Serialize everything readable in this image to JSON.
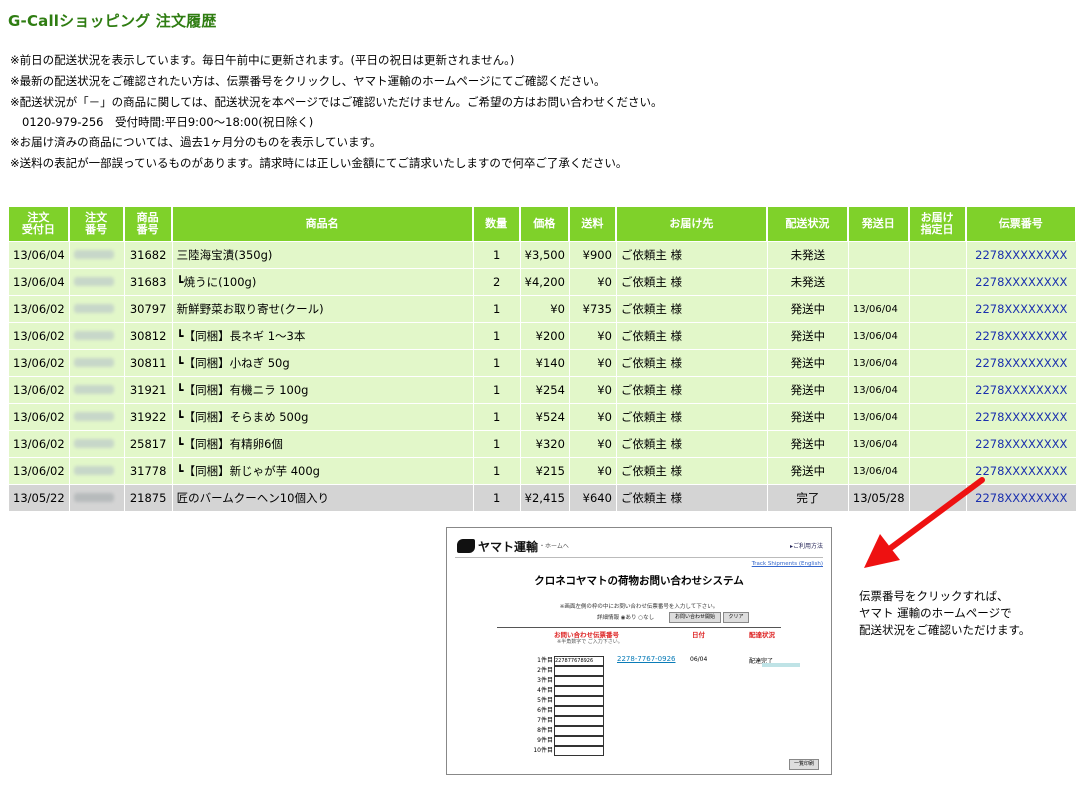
{
  "title": "G-Callショッピング 注文履歴",
  "notes": [
    "※前日の配送状況を表示しています。毎日午前中に更新されます。(平日の祝日は更新されません。)",
    "※最新の配送状況をご確認されたい方は、伝票番号をクリックし、ヤマト運輸のホームページにてご確認ください。",
    "※配送状況が「－」の商品に関しては、配送状況を本ページではご確認いただけません。ご希望の方はお問い合わせください。",
    "0120-979-256　受付時間:平日9:00～18:00(祝日除く)",
    "※お届け済みの商品については、過去1ヶ月分のものを表示しています。",
    "※送料の表記が一部誤っているものがあります。請求時には正しい金額にてご請求いたしますので何卒ご了承ください。"
  ],
  "table": {
    "headers": {
      "order_date": [
        "注文",
        "受付日"
      ],
      "order_no": [
        "注文",
        "番号"
      ],
      "product_no": [
        "商品",
        "番号"
      ],
      "product_name": "商品名",
      "qty": "数量",
      "price": "価格",
      "shipping": "送料",
      "recipient": "お届け先",
      "status": "配送状況",
      "ship_date": "発送日",
      "delivery_date": [
        "お届け",
        "指定日"
      ],
      "slip_no": "伝票番号"
    },
    "rows": [
      {
        "date": "13/06/04",
        "product_no": "31682",
        "name": "三陸海宝漬(350g)",
        "qty": "1",
        "price": "¥3,500",
        "shipping": "¥900",
        "recipient": "ご依頼主 様",
        "status": "未発送",
        "ship_date": "",
        "slip": "2278XXXXXXXX",
        "style": "green"
      },
      {
        "date": "13/06/04",
        "product_no": "31683",
        "name": "┗焼うに(100g)",
        "qty": "2",
        "price": "¥4,200",
        "shipping": "¥0",
        "recipient": "ご依頼主 様",
        "status": "未発送",
        "ship_date": "",
        "slip": "2278XXXXXXXX",
        "style": "green"
      },
      {
        "date": "13/06/02",
        "product_no": "30797",
        "name": "新鮮野菜お取り寄せ(クール)",
        "qty": "1",
        "price": "¥0",
        "shipping": "¥735",
        "recipient": "ご依頼主 様",
        "status": "発送中",
        "ship_date": "13/06/04",
        "slip": "2278XXXXXXXX",
        "style": "green"
      },
      {
        "date": "13/06/02",
        "product_no": "30812",
        "name": "┗【同梱】長ネギ 1～3本",
        "qty": "1",
        "price": "¥200",
        "shipping": "¥0",
        "recipient": "ご依頼主 様",
        "status": "発送中",
        "ship_date": "13/06/04",
        "slip": "2278XXXXXXXX",
        "style": "green"
      },
      {
        "date": "13/06/02",
        "product_no": "30811",
        "name": "┗【同梱】小ねぎ 50g",
        "qty": "1",
        "price": "¥140",
        "shipping": "¥0",
        "recipient": "ご依頼主 様",
        "status": "発送中",
        "ship_date": "13/06/04",
        "slip": "2278XXXXXXXX",
        "style": "green"
      },
      {
        "date": "13/06/02",
        "product_no": "31921",
        "name": "┗【同梱】有機ニラ 100g",
        "qty": "1",
        "price": "¥254",
        "shipping": "¥0",
        "recipient": "ご依頼主 様",
        "status": "発送中",
        "ship_date": "13/06/04",
        "slip": "2278XXXXXXXX",
        "style": "green"
      },
      {
        "date": "13/06/02",
        "product_no": "31922",
        "name": "┗【同梱】そらまめ 500g",
        "qty": "1",
        "price": "¥524",
        "shipping": "¥0",
        "recipient": "ご依頼主 様",
        "status": "発送中",
        "ship_date": "13/06/04",
        "slip": "2278XXXXXXXX",
        "style": "green"
      },
      {
        "date": "13/06/02",
        "product_no": "25817",
        "name": "┗【同梱】有精卵6個",
        "qty": "1",
        "price": "¥320",
        "shipping": "¥0",
        "recipient": "ご依頼主 様",
        "status": "発送中",
        "ship_date": "13/06/04",
        "slip": "2278XXXXXXXX",
        "style": "green"
      },
      {
        "date": "13/06/02",
        "product_no": "31778",
        "name": "┗【同梱】新じゃが芋 400g",
        "qty": "1",
        "price": "¥215",
        "shipping": "¥0",
        "recipient": "ご依頼主 様",
        "status": "発送中",
        "ship_date": "13/06/04",
        "slip": "2278XXXXXXXX",
        "style": "green"
      },
      {
        "date": "13/05/22",
        "product_no": "21875",
        "name": "匠のバームクーヘン10個入り",
        "qty": "1",
        "price": "¥2,415",
        "shipping": "¥640",
        "recipient": "ご依頼主 様",
        "status": "完了",
        "ship_date": "13/05/28",
        "slip": "2278XXXXXXXX",
        "style": "gray"
      }
    ]
  },
  "screenshot": {
    "logo": "ヤマト運輸",
    "home_link": "・ホームへ",
    "help_link": "▸ご利用方法",
    "track_link": "Track Shipments (English)",
    "system_title": "クロネコヤマトの荷物お問い合わせシステム",
    "instruction": "※画面左側の枠の中にお問い合わせ伝票番号を入力して下さい。",
    "detail_label": "詳細情報 ◉あり ○なし",
    "search_button": "お問い合わせ開始",
    "clear_button": "クリア",
    "col_slip": "お問い合わせ伝票番号",
    "col_date": "日付",
    "col_status": "配達状況",
    "note": "※半角数字で ご入力下さい。",
    "row_labels": [
      "1件目",
      "2件目",
      "3件目",
      "4件目",
      "5件目",
      "6件目",
      "7件目",
      "8件目",
      "9件目",
      "10件目"
    ],
    "first_input": "227877678926",
    "tracking_number": "2278-7767-0926",
    "tracking_date": "06/04",
    "tracking_status": "配達完了",
    "list_button": "一覧印刷"
  },
  "explanation": [
    "伝票番号をクリックすれば、",
    "ヤマト 運輸のホームページで",
    "配送状況をご確認いただけます。"
  ],
  "colors": {
    "header_green": "#7fd12a",
    "row_green": "#e2f7c9",
    "row_gray": "#d4d4d4",
    "title_green": "#2f7d12",
    "link_blue": "#1a2fae",
    "arrow_red": "#ee1111"
  }
}
